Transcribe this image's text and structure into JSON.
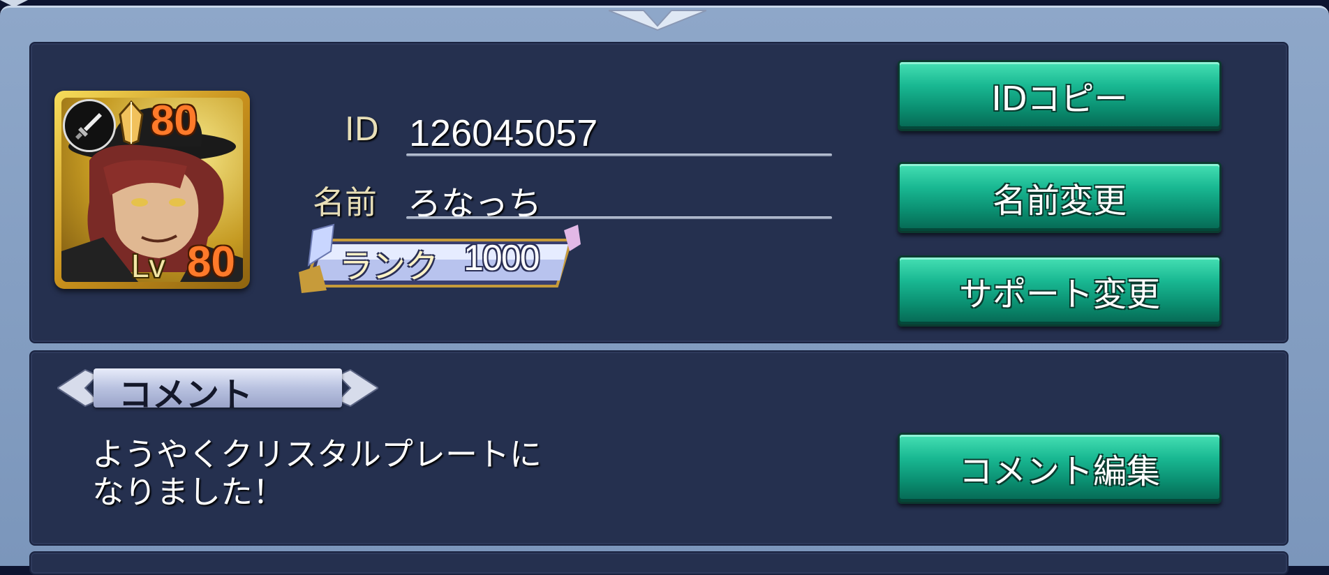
{
  "profile": {
    "avatar": {
      "weapon_icon": "sword-icon",
      "crystal_icon": "crystal-icon",
      "level_top": "80",
      "lv_label": "Lv",
      "lv_value": "80"
    },
    "id_label": "ID",
    "id_value": "126045057",
    "name_label": "名前",
    "name_value": "ろなっち",
    "rank_label": "ランク",
    "rank_value": "1000"
  },
  "buttons": {
    "copy_id": "IDコピー",
    "change_name": "名前変更",
    "change_support": "サポート変更",
    "edit_comment": "コメント編集"
  },
  "comment": {
    "title": "コメント",
    "line1": "ようやくクリスタルプレートに",
    "line2": "なりました！"
  },
  "colors": {
    "frame": "#7b96bb",
    "panel": "#25304f",
    "button_green": "#19b892",
    "level_orange": "#ff7a2a"
  }
}
